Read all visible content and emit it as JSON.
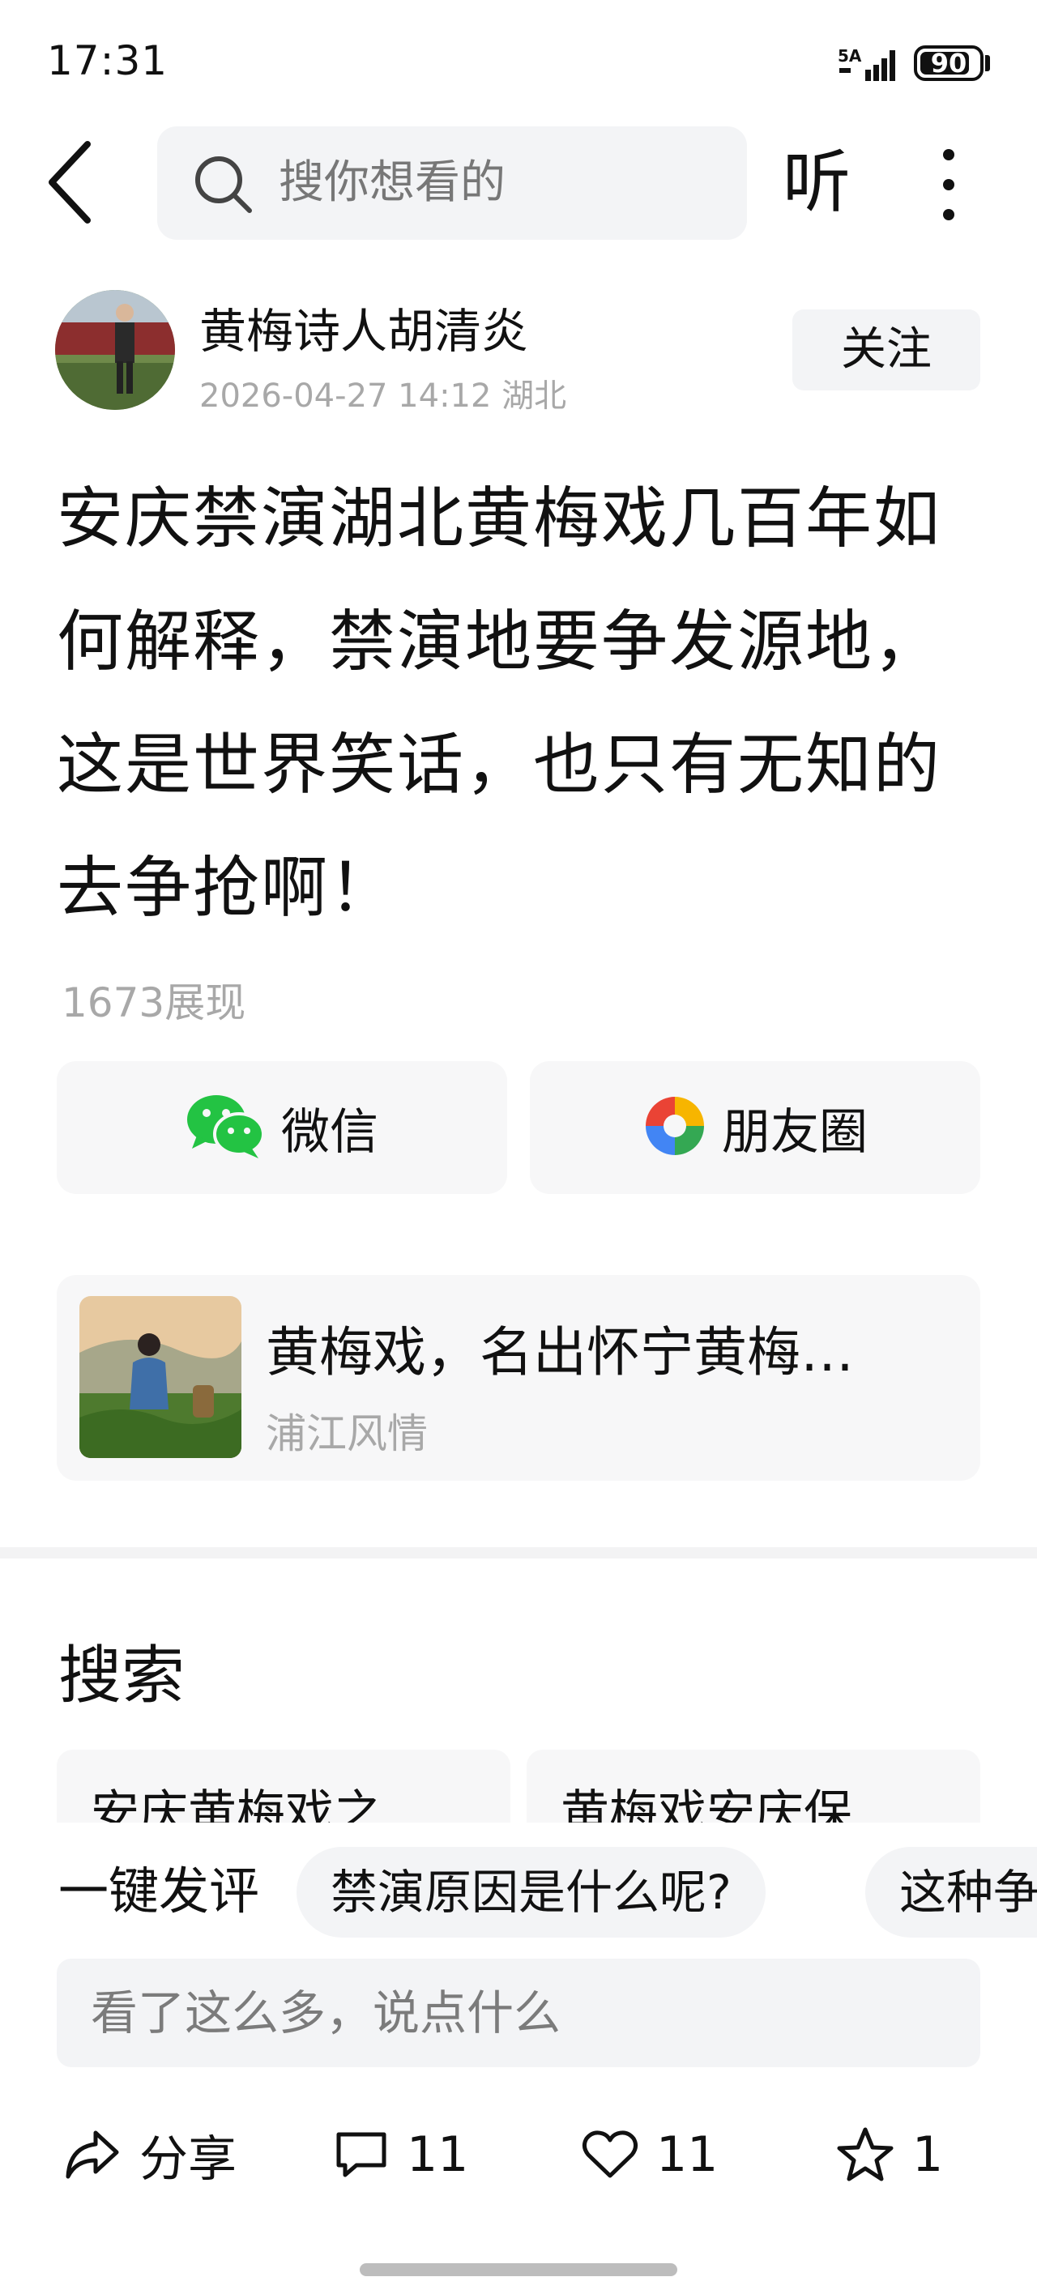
{
  "status_bar": {
    "time": "17:31",
    "network": "5A",
    "battery": "90"
  },
  "top_bar": {
    "search_placeholder": "搜你想看的",
    "listen_label": "听"
  },
  "author": {
    "name": "黄梅诗人胡清炎",
    "meta": "2026-04-27 14:12 湖北",
    "follow_label": "关注"
  },
  "article": {
    "title": "安庆禁演湖北黄梅戏几百年如何解释，禁演地要争发源地，这是世界笑话，也只有无知的去争抢啊！",
    "views": "1673展现"
  },
  "share": {
    "wechat_label": "微信",
    "moments_label": "朋友圈"
  },
  "related": {
    "title": "黄梅戏，名出怀宁黄梅…",
    "source": "浦江风情"
  },
  "search_section": {
    "heading": "搜索",
    "items": [
      "安庆黄梅戏之…",
      "黄梅戏安庆保…"
    ]
  },
  "comment": {
    "quick_label": "一键发评",
    "quick_chips": [
      "禁演原因是什么呢?",
      "这种争"
    ],
    "input_placeholder": "看了这么多，说点什么"
  },
  "actions": {
    "share_label": "分享",
    "comments": "11",
    "likes": "11",
    "favorites": "1"
  },
  "colors": {
    "text": "#111111",
    "muted": "#a8a8a8",
    "chip_bg": "#f3f4f6",
    "wechat_green": "#23c343"
  }
}
